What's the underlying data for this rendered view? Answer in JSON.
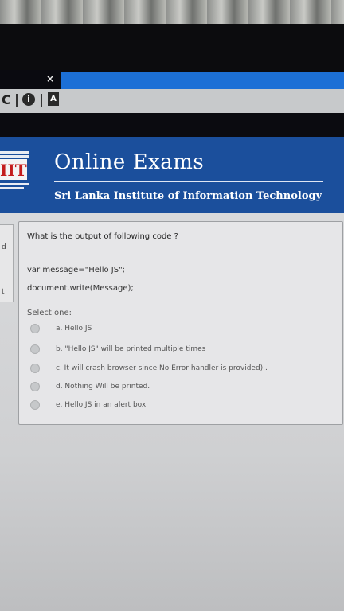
{
  "browser": {
    "tab_close": "×",
    "reload_icon": "C",
    "info_icon": "i",
    "doc_icon": "A"
  },
  "header": {
    "logo_text": "IIT",
    "title": "Online Exams",
    "subtitle": "Sri Lanka Institute of Information Technology",
    "background": "#1b4f9c",
    "logo_color": "#c31c1c"
  },
  "side": {
    "marks": [
      "d",
      "t"
    ]
  },
  "question": {
    "text": "What is the output of following code ?",
    "code": [
      "var message=\"Hello JS\";",
      "document.write(Message);"
    ],
    "select_label": "Select one:",
    "options": [
      "a. Hello JS",
      "b. \"Hello JS\" will be printed multiple times",
      "c. It will crash browser since No Error handler is provided) .",
      "d. Nothing Will be printed.",
      "e. Hello JS in an alert box"
    ]
  }
}
